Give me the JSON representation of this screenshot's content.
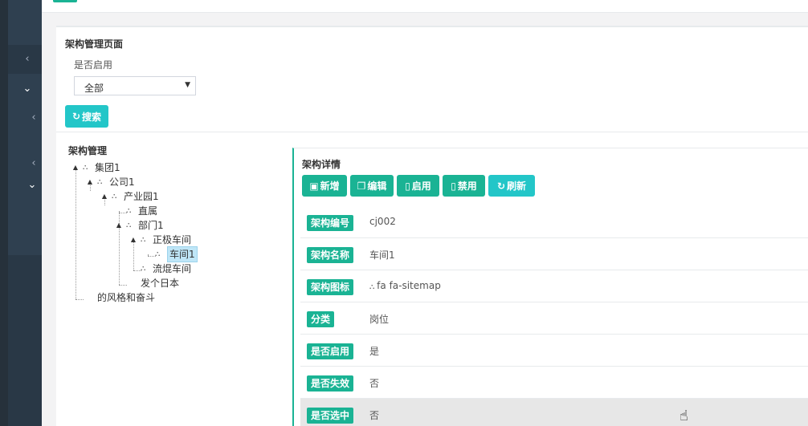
{
  "sidebar": {
    "icons": [
      {
        "name": "chevron-left-icon",
        "glyph": "‹"
      },
      {
        "name": "chevron-down-icon",
        "glyph": "⌄"
      },
      {
        "name": "chevron-left-icon",
        "glyph": "‹"
      },
      {
        "name": "chevron-left-icon",
        "glyph": "‹"
      },
      {
        "name": "chevron-down-icon",
        "glyph": "⌄"
      }
    ]
  },
  "page": {
    "title": "架构管理页面",
    "filter_label": "是否启用",
    "filter_value": "全部",
    "search_label": "搜索",
    "search_icon": "↻"
  },
  "tree": {
    "title": "架构管理",
    "nodes": [
      {
        "label": "集团1"
      },
      {
        "label": "公司1"
      },
      {
        "label": "产业园1"
      },
      {
        "label": "直属"
      },
      {
        "label": "部门1"
      },
      {
        "label": "正极车间"
      },
      {
        "label": "车间1"
      },
      {
        "label": "流焜车间"
      },
      {
        "label": "发个日本"
      },
      {
        "label": "的风格和奋斗"
      }
    ]
  },
  "detail": {
    "title": "架构详情",
    "buttons": {
      "add": "新增",
      "edit": "编辑",
      "enable": "启用",
      "disable": "禁用",
      "refresh": "刷新"
    },
    "rows": [
      {
        "label": "架构编号",
        "value": "cj002"
      },
      {
        "label": "架构名称",
        "value": "车间1"
      },
      {
        "label": "架构图标",
        "value": "fa fa-sitemap"
      },
      {
        "label": "分类",
        "value": "岗位"
      },
      {
        "label": "是否启用",
        "value": "是"
      },
      {
        "label": "是否失效",
        "value": "否"
      },
      {
        "label": "是否选中",
        "value": "否"
      }
    ]
  },
  "colors": {
    "accent": "#1ab394",
    "info": "#23c6c8",
    "sidebar": "#2f4050"
  }
}
